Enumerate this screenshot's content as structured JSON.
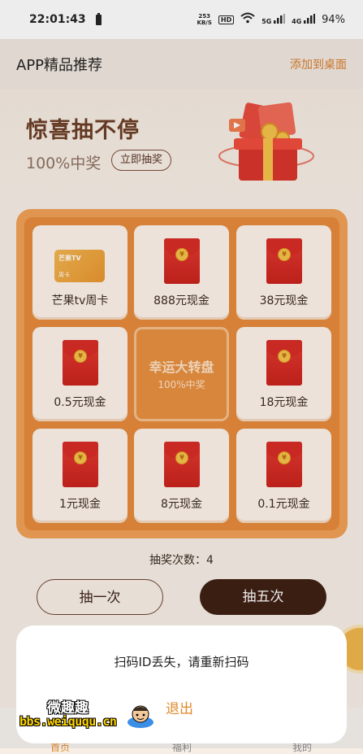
{
  "status_bar": {
    "time": "22:01:43",
    "speed_value": "253",
    "speed_unit": "KB/S",
    "hd": "HD",
    "signal_5g": "5G",
    "signal_4g": "4G",
    "battery": "94%"
  },
  "app_bar": {
    "title": "APP精品推荐",
    "add_to_desktop": "添加到桌面"
  },
  "hero": {
    "headline": "惊喜抽不停",
    "subtitle": "100%中奖",
    "draw_now": "立即抽奖"
  },
  "grid": {
    "cells": [
      {
        "label": "芒果tv周卡",
        "card_brand": "芒果TV",
        "card_type": "周卡"
      },
      {
        "label": "888元现金"
      },
      {
        "label": "38元现金"
      },
      {
        "label": "0.5元现金"
      },
      {
        "center_title": "幸运大转盘",
        "center_sub": "100%中奖"
      },
      {
        "label": "18元现金"
      },
      {
        "label": "1元现金"
      },
      {
        "label": "8元现金"
      },
      {
        "label": "0.1元现金"
      }
    ],
    "coin_symbol": "¥"
  },
  "draw_count": "抽奖次数：4",
  "buttons": {
    "once": "抽一次",
    "five": "抽五次"
  },
  "dialog": {
    "message": "扫码ID丢失，请重新扫码",
    "exit": "退出"
  },
  "tabs": [
    {
      "label": "首页"
    },
    {
      "label": "福利"
    },
    {
      "label": "我的"
    }
  ],
  "watermark": {
    "title": "微趣趣",
    "url": "bbs.weiququ.cn"
  }
}
